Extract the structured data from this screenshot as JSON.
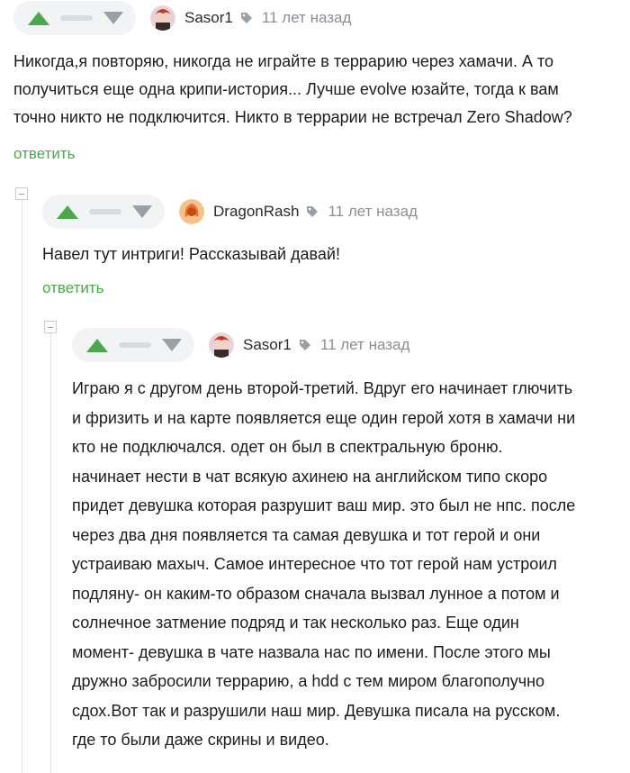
{
  "comments": [
    {
      "username": "Sasor1",
      "time": "11 лет назад",
      "lines": [
        "Никогда,я повторяю, никогда не играйте в террарию через хамачи. А то",
        "получиться еще одна крипи-история... Лучше evolve юзайте, тогда к вам",
        "точно никто не подключится. Никто в террарии не встречал Zero Shadow?"
      ],
      "reply_label": "ответить"
    },
    {
      "username": "DragonRash",
      "time": "11 лет назад",
      "lines": [
        "Навел тут интриги! Рассказывай давай!"
      ],
      "reply_label": "ответить"
    },
    {
      "username": "Sasor1",
      "time": "11 лет назад",
      "lines": [
        "Играю я с другом день второй-третий. Вдруг его начинает глючить",
        "и фризить и на карте появляется еще один герой хотя в хамачи ни",
        "кто не подключался. одет он был в спектральную броню.",
        "начинает нести в чат всякую ахинею на английском типо скоро",
        "придет девушка которая разрушит ваш мир. это был не нпс. после",
        "через два дня появляется та самая девушка и тот герой и они",
        "устраиваю махыч. Самое интересное что тот герой нам устроил",
        "подляну- он каким-то образом сначала вызвал лунное а потом и",
        "солнечное затмение подряд и так несколько раз. Еще один",
        "момент- девушка в чате назвала нас по имени. После этого мы",
        "дружно забросили террарию, а hdd с тем миром благополучно",
        "сдох.Вот так и разрушили наш мир. Девушка писала на русском.",
        "где то были даже скрины и видео."
      ]
    }
  ],
  "colors": {
    "upvote": "#4aa84d",
    "downvote": "#9aa0a8",
    "reply": "#4aa84d",
    "time": "#8a8f96"
  },
  "icons": [
    "upvote-arrow-icon",
    "downvote-arrow-icon",
    "tag-icon",
    "collapse-icon"
  ]
}
